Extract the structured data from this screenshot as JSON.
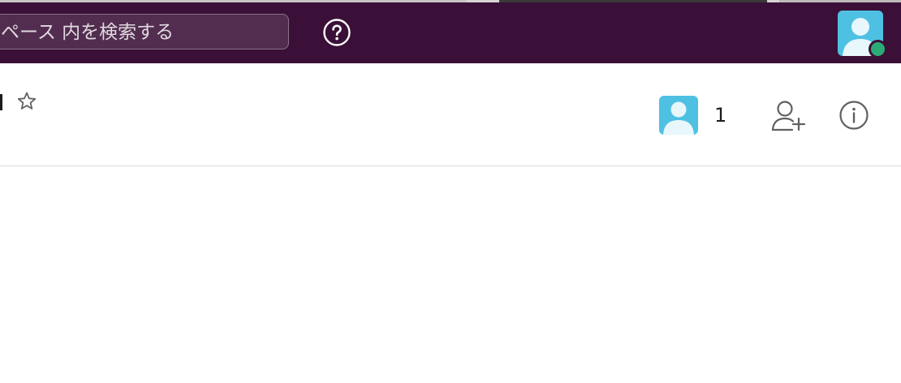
{
  "search": {
    "placeholder": "ペース 内を検索する"
  },
  "topbar": {
    "help_icon": "question-circle-icon",
    "user_avatar_icon": "person-icon",
    "presence_status": "active",
    "colors": {
      "background": "#3b1038",
      "presence": "#2bac76",
      "avatar": "#4ec1e3"
    }
  },
  "channel_header": {
    "star_icon": "star-icon",
    "member_count": "1",
    "add_member_icon": "add-person-icon",
    "info_icon": "info-circle-icon"
  }
}
